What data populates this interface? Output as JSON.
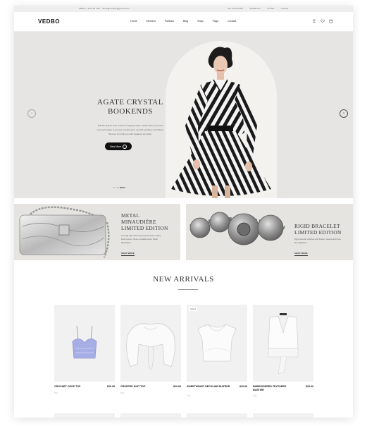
{
  "topbar": {
    "contact": "FREE: +123 45 789  ·  Shop@vedbo@gmail.com",
    "links": [
      "MY ACCOUNT",
      "WISHLIST",
      "$ USD",
      "LOGIN"
    ]
  },
  "header": {
    "logo": "VEDBO",
    "nav": [
      "Home",
      "Element",
      "Portfolio",
      "Blog",
      "Shop",
      "Page",
      "Contact"
    ],
    "icons": [
      "user-icon",
      "heart-icon",
      "bag-icon"
    ]
  },
  "hero": {
    "title_line1": "AGATE CRYSTAL",
    "title_line2": "BOOKENDS",
    "desc_line1": "Soft but distinct lines create an elegant profile. Perfect when you want",
    "desc_line2": "your work space in an open environment, yet with sensitive and refined.",
    "desc_line3": "We love it in both you with elegance and style.",
    "button": "View More",
    "pager_prefix": "01 / 02",
    "pager_label": "NEXT"
  },
  "promos": [
    {
      "title_line1": "METAL",
      "title_line2": "MINAUDIÈRE",
      "title_line3": "LIMITED EDITION",
      "desc_line1": "Our bag with raised and pared exterior. Shiny",
      "desc_line2": "lined interior. Close a metallic strap. Metal",
      "desc_line3": "Minaudiere",
      "link": "SHOP MORE"
    },
    {
      "title_line1": "RIGID BRACELET",
      "title_line2": "LIMITED EDITION",
      "desc_line1": "Rigid bracelet clutched with flowers, leaves and three",
      "desc_line2": "fine appliqués.",
      "link": "SHOP MORE"
    }
  ],
  "new_arrivals": {
    "title": "NEW ARRIVALS",
    "products": [
      {
        "name": "CROCHET CROP TOP",
        "price": "$29.99",
        "category": "Tops",
        "badge": ""
      },
      {
        "name": "CROPPED KNIT TOP",
        "price": "$29.99",
        "category": "Tops",
        "badge": ""
      },
      {
        "name": "SWEETHEART NECKLINE BUSTIER",
        "price": "$29.99",
        "category": "Tops",
        "badge": "SALE"
      },
      {
        "name": "EMBROIDERED TEXTURED BUSTIER",
        "price": "$29.99",
        "category": "Tops",
        "badge": ""
      }
    ]
  }
}
